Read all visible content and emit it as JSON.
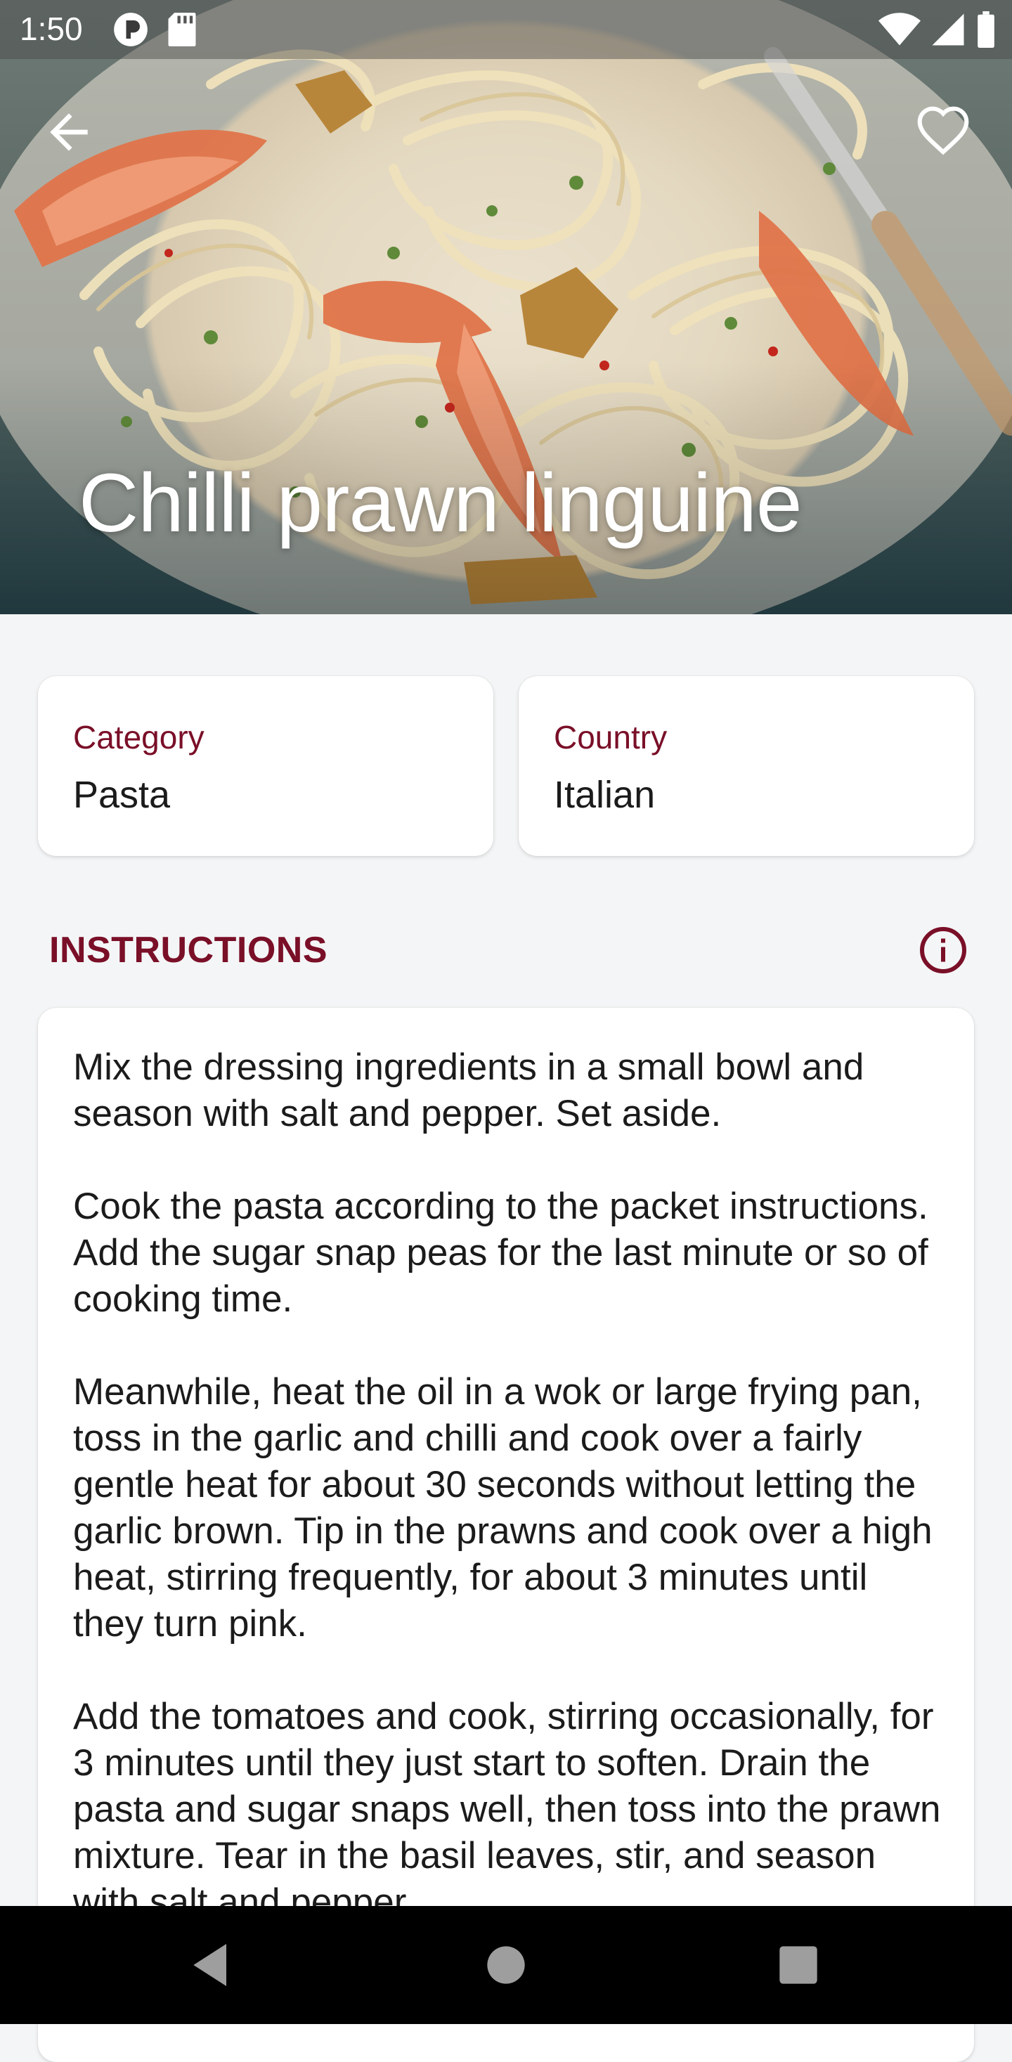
{
  "status_bar": {
    "time": "1:50",
    "left_icons": [
      "notification-app-icon",
      "sd-card-icon"
    ],
    "right_icons": [
      "wifi-icon",
      "signal-icon",
      "battery-icon"
    ]
  },
  "header": {
    "back_icon": "arrow-left-icon",
    "favorite_icon": "heart-outline-icon"
  },
  "recipe": {
    "title": "Chilli prawn linguine"
  },
  "details": {
    "category_label": "Category",
    "category_value": "Pasta",
    "country_label": "Country",
    "country_value": "Italian"
  },
  "instructions": {
    "heading": "INSTRUCTIONS",
    "info_icon": "info-circle-icon",
    "paragraphs": [
      "Mix the dressing ingredients in a small bowl and season with salt and pepper. Set aside.",
      "Cook the pasta according to the packet instructions. Add the sugar snap peas for the last minute or so of cooking time.",
      "Meanwhile, heat the oil in a wok or large frying pan, toss in the garlic and chilli and cook over a fairly gentle heat for about 30 seconds without letting the garlic brown. Tip in the prawns and cook over a high heat, stirring frequently, for about 3 minutes until they turn pink.",
      "Add the tomatoes and cook, stirring occasionally, for 3 minutes until they just start to soften. Drain the pasta and sugar snaps well, then toss into the prawn mixture. Tear in the basil leaves, stir, and season with salt and pepper."
    ]
  },
  "colors": {
    "accent": "#7a0f28",
    "background": "#f4f5f6",
    "card": "#ffffff",
    "text": "#1b1b1b"
  },
  "nav_bar": {
    "icons": [
      "back-triangle-icon",
      "home-circle-icon",
      "recents-square-icon"
    ]
  }
}
